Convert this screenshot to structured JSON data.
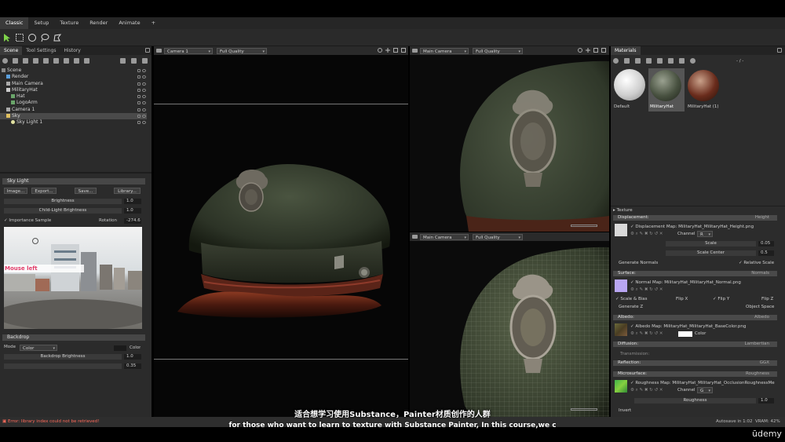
{
  "menu": {
    "tabs": [
      "Classic",
      "Setup",
      "Texture",
      "Render",
      "Animate",
      "+"
    ]
  },
  "scene_panel": {
    "tabs": [
      "Scene",
      "Tool Settings",
      "History"
    ],
    "tree": [
      {
        "label": "Scene",
        "indent": 0
      },
      {
        "label": "Render",
        "indent": 1
      },
      {
        "label": "Main Camera",
        "indent": 1
      },
      {
        "label": "MilitaryHat",
        "indent": 1
      },
      {
        "label": "Hat",
        "indent": 2
      },
      {
        "label": "LogoArm",
        "indent": 2
      },
      {
        "label": "Camera 1",
        "indent": 1
      },
      {
        "label": "Sky",
        "indent": 1
      },
      {
        "label": "Sky Light 1",
        "indent": 2
      }
    ]
  },
  "sky_light": {
    "header": "Sky Light",
    "buttons": [
      "Image...",
      "Export...",
      "Save...",
      "Library..."
    ],
    "brightness_label": "Brightness",
    "brightness_value": "1.0",
    "child_brightness_label": "Child-Light Brightness",
    "child_brightness_value": "1.0",
    "importance_label": "Importance Sample",
    "rotation_label": "Rotation",
    "rotation_value": "-274.6",
    "mouse_tooltip": "Mouse left"
  },
  "backdrop": {
    "header": "Backdrop",
    "mode_label": "Mode",
    "mode_value": "Color",
    "color_label": "Color",
    "brightness_label": "Backdrop Brightness",
    "brightness_value": "1.0",
    "extra_value": "0.35"
  },
  "viewports": {
    "left": {
      "camera": "Camera 1",
      "quality": "Full Quality"
    },
    "right_top": {
      "camera": "Main Camera",
      "quality": "Full Quality"
    },
    "right_bottom": {
      "camera": "Main Camera",
      "quality": "Full Quality"
    }
  },
  "materials": {
    "title": "Materials",
    "search_value": "- / -",
    "swatches": [
      "Default",
      "MilitaryHat",
      "MilitaryHat (1)"
    ],
    "texture_header": "Texture",
    "displacement": {
      "header": "Displacement:",
      "mode": "Height",
      "map_label": "Displacement Map:",
      "map_file": "MilitaryHat_MilitaryHat_Height.png",
      "channel_label": "Channel",
      "channel_value": "R",
      "scale_label": "Scale",
      "scale_value": "0.05",
      "scale_center_label": "Scale Center",
      "scale_center_value": "0.5",
      "generate_normals": "Generate Normals",
      "relative_scale": "Relative Scale"
    },
    "surface": {
      "header": "Surface:",
      "mode": "Normals",
      "map_label": "Normal Map:",
      "map_file": "MilitaryHat_MilitaryHat_Normal.png",
      "scale_bias": "Scale & Bias",
      "flip_x": "Flip X",
      "flip_y": "Flip Y",
      "flip_z": "Flip Z",
      "generate_z": "Generate Z",
      "object_space": "Object Space"
    },
    "albedo": {
      "header": "Albedo:",
      "mode": "Albedo",
      "map_label": "Albedo Map:",
      "map_file": "MilitaryHat_MilitaryHat_BaseColor.png",
      "color_label": "Color"
    },
    "diffusion": {
      "header": "Diffusion:",
      "mode": "Lambertian",
      "transmission": "Transmission:"
    },
    "reflection": {
      "header": "Reflection:",
      "mode": "GGX"
    },
    "microsurface": {
      "header": "Microsurface:",
      "mode": "Roughness",
      "map_label": "Roughness Map:",
      "map_file": "MilitaryHat_MilitaryHat_OcclusionRoughnessMe",
      "channel_label": "Channel",
      "channel_value": "G",
      "roughness_label": "Roughness",
      "roughness_value": "1.0",
      "invert_label": "Invert"
    }
  },
  "status": {
    "error": "Error: library index could not be retrieved!",
    "autosave": "Autosave in 1:02",
    "vram": "VRAM: 42%"
  },
  "subtitles": {
    "chinese": "适合想学习使用Substance，Painter材质创作的人群",
    "english": "for those who want to learn to texture with Substance Painter, In this course,we c"
  },
  "watermark": "ūdemy"
}
